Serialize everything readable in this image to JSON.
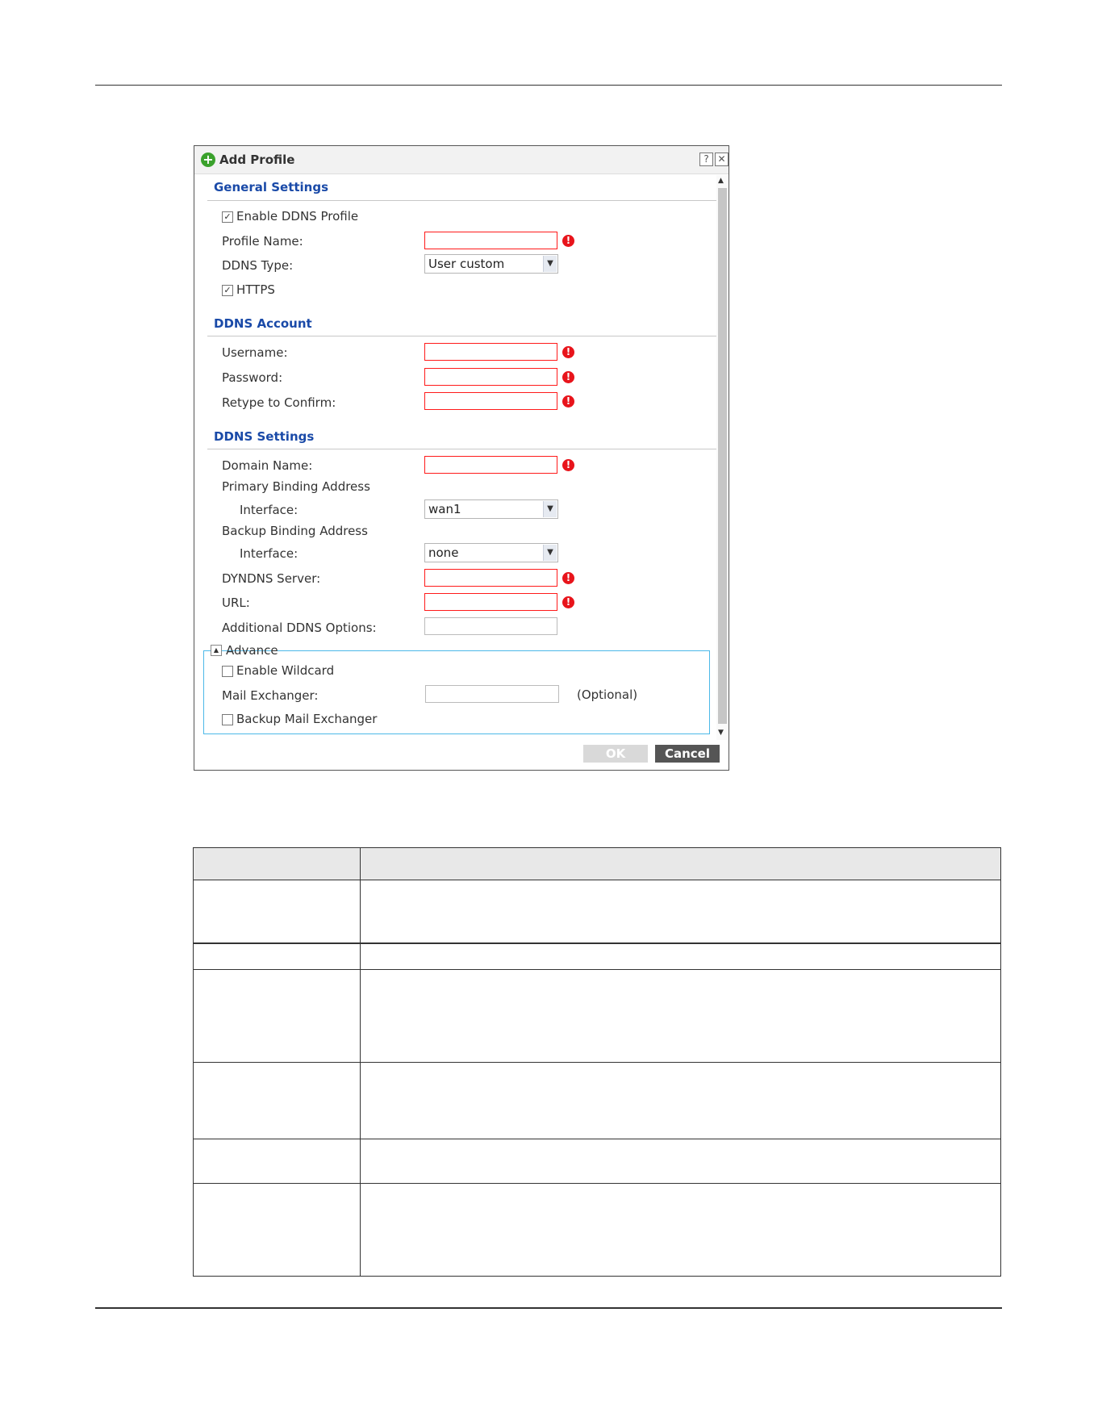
{
  "dialog": {
    "title": "Add Profile",
    "help_symbol": "?",
    "close_symbol": "✕",
    "error_symbol": "!",
    "sections": {
      "general": "General Settings",
      "account": "DDNS Account",
      "settings": "DDNS Settings"
    },
    "general": {
      "enable_ddns_profile": {
        "label": "Enable DDNS Profile",
        "checked": true
      },
      "profile_name_label": "Profile Name:",
      "profile_name_value": "",
      "ddns_type_label": "DDNS Type:",
      "ddns_type_value": "User custom",
      "https": {
        "label": "HTTPS",
        "checked": true
      }
    },
    "account": {
      "username_label": "Username:",
      "password_label": "Password:",
      "retype_label": "Retype to Confirm:"
    },
    "settings": {
      "domain_name_label": "Domain Name:",
      "primary_binding_label": "Primary Binding Address",
      "primary_interface_label": "Interface:",
      "primary_interface_value": "wan1",
      "backup_binding_label": "Backup Binding Address",
      "backup_interface_label": "Interface:",
      "backup_interface_value": "none",
      "dyndns_server_label": "DYNDNS Server:",
      "url_label": "URL:",
      "additional_options_label": "Additional DDNS Options:"
    },
    "advance": {
      "legend": "Advance",
      "enable_wildcard": {
        "label": "Enable Wildcard",
        "checked": false
      },
      "mail_exchanger_label": "Mail Exchanger:",
      "mail_exchanger_hint": "(Optional)",
      "backup_mail_exchanger": {
        "label": "Backup Mail Exchanger",
        "checked": false
      }
    },
    "buttons": {
      "ok": "OK",
      "cancel": "Cancel"
    }
  },
  "colors": {
    "section_title": "#1a4aa8",
    "error_border": "#ff1a1a",
    "error_icon": "#e8141b",
    "advance_border": "#4cb8e8",
    "add_icon": "#3aa12c",
    "cancel_button": "#555555"
  },
  "icons": {
    "add": "plus-circle-icon",
    "help": "help-icon",
    "close": "close-icon",
    "error": "error-icon",
    "dropdown": "chevron-down-icon"
  }
}
